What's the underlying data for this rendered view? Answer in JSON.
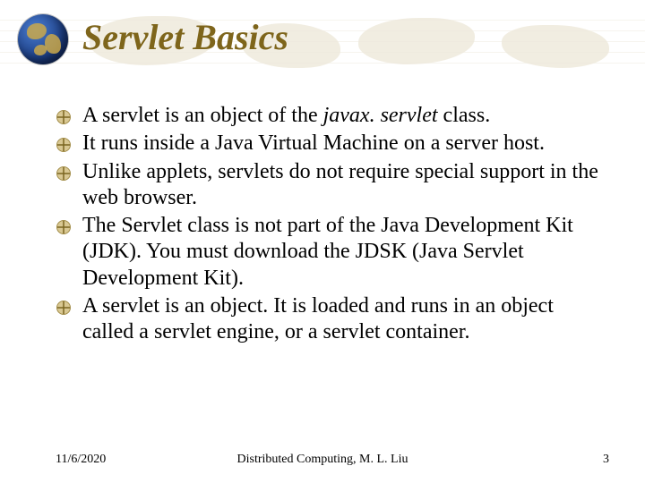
{
  "title": "Servlet Basics",
  "bullets": [
    {
      "pre": "A servlet is an object of the ",
      "em": "javax. servlet",
      "post": " class."
    },
    {
      "pre": "It runs inside a Java Virtual Machine on a server host.",
      "em": "",
      "post": ""
    },
    {
      "pre": "Unlike applets, servlets do not require special support in the web browser.",
      "em": "",
      "post": ""
    },
    {
      "pre": "The Servlet class is not part of the Java Development Kit (JDK).  You must download the JDSK (Java Servlet Development Kit).",
      "em": "",
      "post": ""
    },
    {
      "pre": "A servlet is an object. It is loaded and runs in an object called a servlet engine, or a servlet container.",
      "em": "",
      "post": ""
    }
  ],
  "footer": {
    "date": "11/6/2020",
    "center": "Distributed Computing, M. L. Liu",
    "page": "3"
  }
}
